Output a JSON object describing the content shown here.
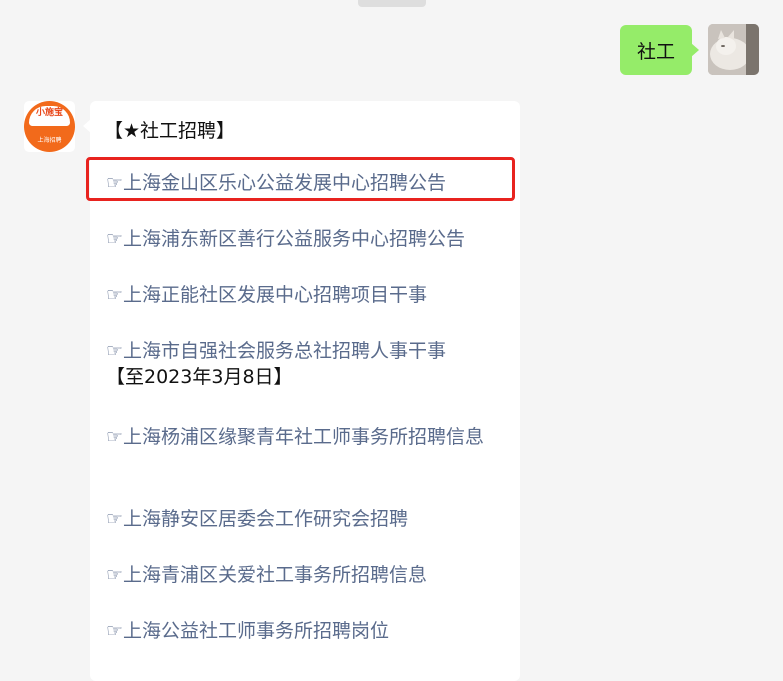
{
  "outgoing": {
    "text": "社工"
  },
  "incoming": {
    "bot_avatar": {
      "logo_text": "小施宝",
      "sub_text": "上海招聘"
    },
    "heading": "【★社工招聘】",
    "links": [
      {
        "text": "☞上海金山区乐心公益发展中心招聘公告",
        "highlighted": true
      },
      {
        "text": "☞上海浦东新区善行公益服务中心招聘公告"
      },
      {
        "text": "☞上海正能社区发展中心招聘项目干事"
      },
      {
        "text": "☞上海市自强社会服务总社招聘人事干事",
        "suffix": "【至2023年3月8日】"
      },
      {
        "text": "☞上海杨浦区缘聚青年社工师事务所招聘信息"
      },
      {
        "text": "☞上海静安区居委会工作研究会招聘"
      },
      {
        "text": "☞上海青浦区关爱社工事务所招聘信息"
      },
      {
        "text": "☞上海公益社工师事务所招聘岗位"
      }
    ]
  },
  "colors": {
    "outgoing_bubble": "#95ec69",
    "incoming_bubble": "#ffffff",
    "link_text": "#5a6b8c",
    "highlight_border": "#e8231f",
    "background": "#f5f5f5"
  }
}
